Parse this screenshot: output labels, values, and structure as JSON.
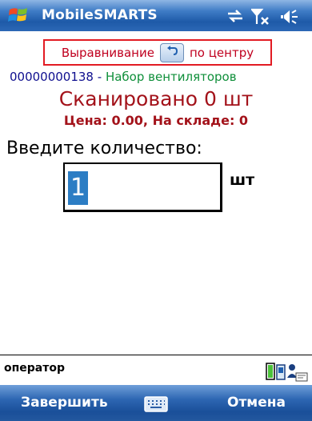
{
  "titlebar": {
    "app_title": "MobileSMARTS",
    "icons": [
      "windows-start-icon",
      "connectivity-icon",
      "signal-off-icon",
      "volume-icon"
    ]
  },
  "alignment": {
    "label": "Выравнивание",
    "value": "по центру",
    "button_icon": "undo-arrow-icon"
  },
  "product": {
    "code": "00000000138",
    "separator": " - ",
    "name": "Набор вентиляторов"
  },
  "scanned": "Сканировано 0 шт",
  "price_line": "Цена: 0.00, На складе: 0",
  "quantity": {
    "prompt": "Введите количество:",
    "value": "1",
    "unit": "шт"
  },
  "status": {
    "user": "оператор",
    "icon": "battery-device-icon"
  },
  "softkeys": {
    "left": "Завершить",
    "center_icon": "keyboard-icon",
    "right": "Отмена"
  },
  "colors": {
    "title_bar": "#2c68b6",
    "highlight_border": "#e21b23",
    "scanned_text": "#a3121a",
    "product_code": "#0f0f8f",
    "product_name": "#0f8f3a",
    "selection": "#2c7dc4"
  }
}
